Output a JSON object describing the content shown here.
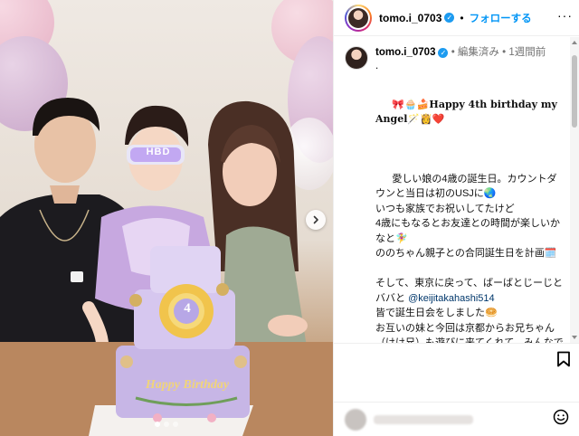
{
  "post": {
    "username": "tomo.i_0703",
    "follow_label": "フォローする",
    "dot": "•",
    "edited_label": "編集済み",
    "time_label": "1週間前",
    "caption_first_line": ".",
    "caption_title": "🎀🧁🍰Happy 4th birthday my Angel🪄👸❤️",
    "caption_body_1": "愛しい娘の4歳の誕生日。カウントダウンと当日は初のUSJに🌏\nいつも家族でお祝いしてたけど\n4歳にもなるとお友達との時間が楽しいかなと🧚‍♀️\nののちゃん親子との合同誕生日を計画🗓️\n\nそして、東京に戻って、ばーばとじーじとババと ",
    "caption_mention": "@keijitakahashi514",
    "caption_body_2": "\n皆で誕生日会をしました🥯\nお互いの妹と今回は京都からお兄ちゃん（けけ兄）も遊びに来てくれて、みんなでお祝いできて最高の誕生日に。\n\nケーキやバルーンはベビちんの大好き"
  },
  "photo": {
    "cake_text": "Happy Birthday",
    "cake_number": "4",
    "glasses_text": "HBD"
  },
  "icons": {
    "verified": "verified-badge-icon",
    "more": "more-options-icon",
    "next": "chevron-right-icon",
    "bookmark": "bookmark-icon",
    "emoji": "emoji-icon"
  },
  "colors": {
    "accent": "#0095f6",
    "verified": "#1d9bf0"
  }
}
